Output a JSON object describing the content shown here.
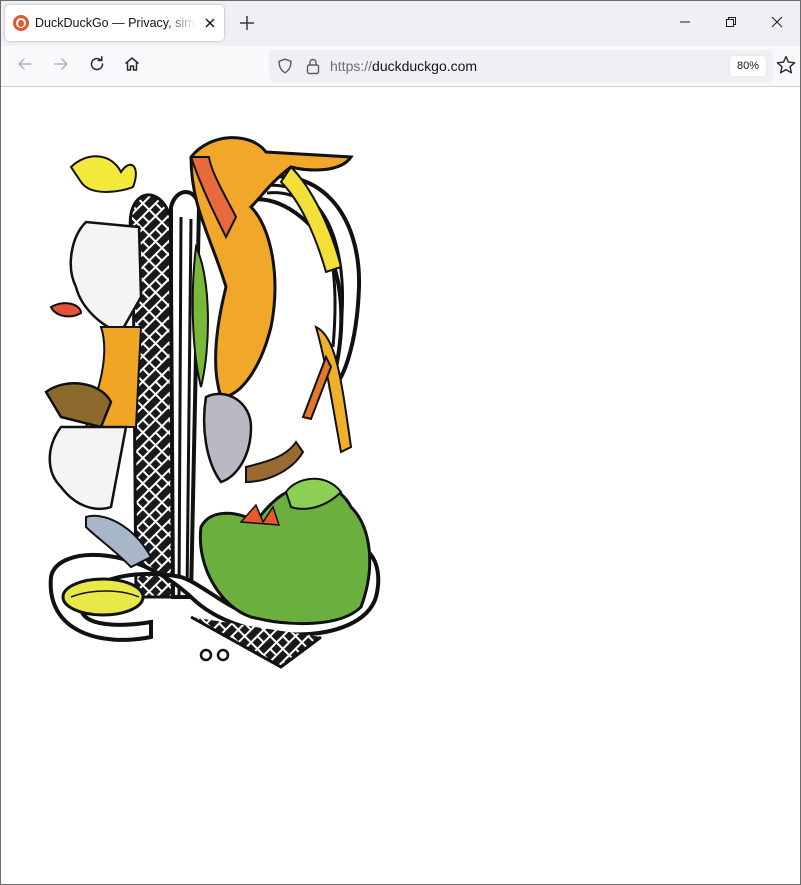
{
  "window": {
    "tab": {
      "title": "DuckDuckGo — Privacy, simplified.",
      "favicon": "duckduckgo-favicon"
    },
    "new_tab_symbol": "+",
    "controls": [
      "minimize-icon",
      "restore-icon",
      "close-icon"
    ]
  },
  "navbar": {
    "url_scheme": "https://",
    "url_host": "duckduckgo.com",
    "zoom": "80%"
  },
  "content": {
    "image": "illuminated-initial-letter-with-dragons"
  },
  "colors": {
    "tabstrip": "#f0f0f4",
    "navbar": "#f9f9fb",
    "urlbar": "#f0f0f4",
    "brand": "#de5833"
  }
}
